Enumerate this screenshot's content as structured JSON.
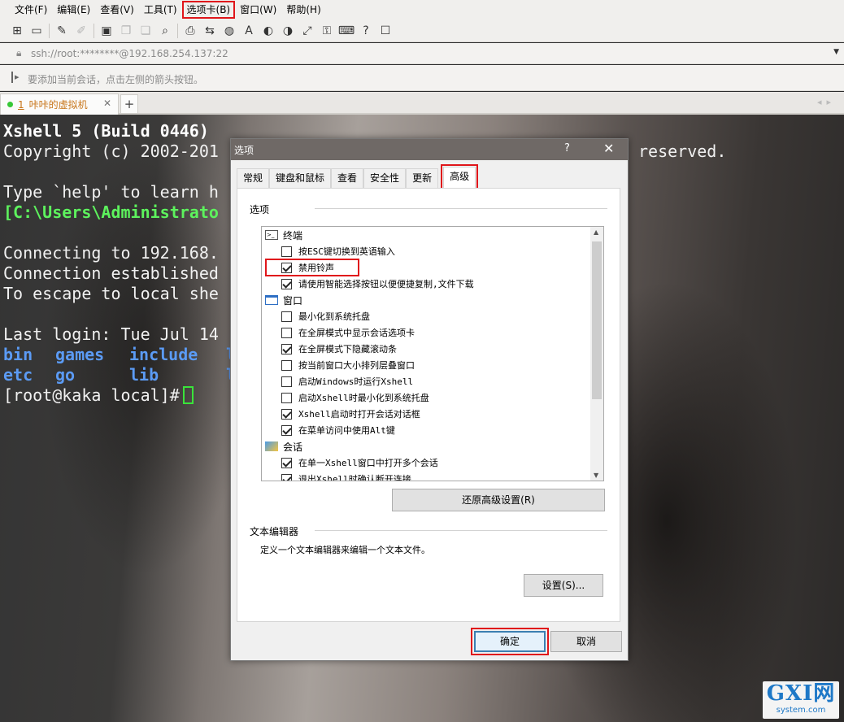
{
  "menu": [
    "文件(F)",
    "编辑(E)",
    "查看(V)",
    "工具(T)",
    "选项卡(B)",
    "窗口(W)",
    "帮助(H)"
  ],
  "address": {
    "text": "ssh://root:********@192.168.254.137:22"
  },
  "hint": {
    "text": "要添加当前会话，点击左侧的箭头按钮。"
  },
  "session_tab": {
    "number": "1",
    "label": "咔咔的虚拟机",
    "add": "+"
  },
  "terminal": {
    "l1": "Xshell 5 (Build 0446)",
    "l2a": "Copyright (c) 2002-201",
    "l2b": "reserved.",
    "l3": "Type `help' to learn h",
    "l4": "[C:\\Users\\Administrato",
    "l5": "Connecting to 192.168.",
    "l6": "Connection established",
    "l7": "To escape to local she",
    "l8": "Last login: Tue Jul 14",
    "l9": [
      "bin",
      "games",
      "include",
      "l"
    ],
    "l10": [
      "etc",
      "go",
      "lib",
      "l"
    ],
    "prompt": "[root@kaka local]#"
  },
  "watermark": {
    "big": "GXI网",
    "small": "system.com"
  },
  "dialog": {
    "title": "选项",
    "help": "?",
    "close": "✕",
    "tabs": [
      "常规",
      "键盘和鼠标",
      "查看",
      "安全性",
      "更新",
      "高级"
    ],
    "options_label": "选项",
    "groups": {
      "terminal": "终端",
      "window": "窗口",
      "session": "会话"
    },
    "items": {
      "esc": "按ESC键切换到英语输入",
      "bell": "禁用铃声",
      "smart": "请使用智能选择按钮以便便捷复制,文件下载",
      "min_tray": "最小化到系统托盘",
      "fs_tabs": "在全屏模式中显示会话选项卡",
      "fs_scroll": "在全屏模式下隐藏滚动条",
      "cascade": "按当前窗口大小排列层叠窗口",
      "startup": "启动Windows时运行Xshell",
      "start_min": "启动Xshell时最小化到系统托盘",
      "open_dlg": "Xshell启动时打开会话对话框",
      "alt": "在菜单访问中使用Alt键",
      "multi": "在单一Xshell窗口中打开多个会话",
      "exit_confirm": "退出Xshell时确认断开连接"
    },
    "restore_button": "还原高级设置(R)",
    "editor_label": "文本编辑器",
    "editor_desc": "定义一个文本编辑器来编辑一个文本文件。",
    "settings_button": "设置(S)...",
    "ok": "确定",
    "cancel": "取消"
  }
}
